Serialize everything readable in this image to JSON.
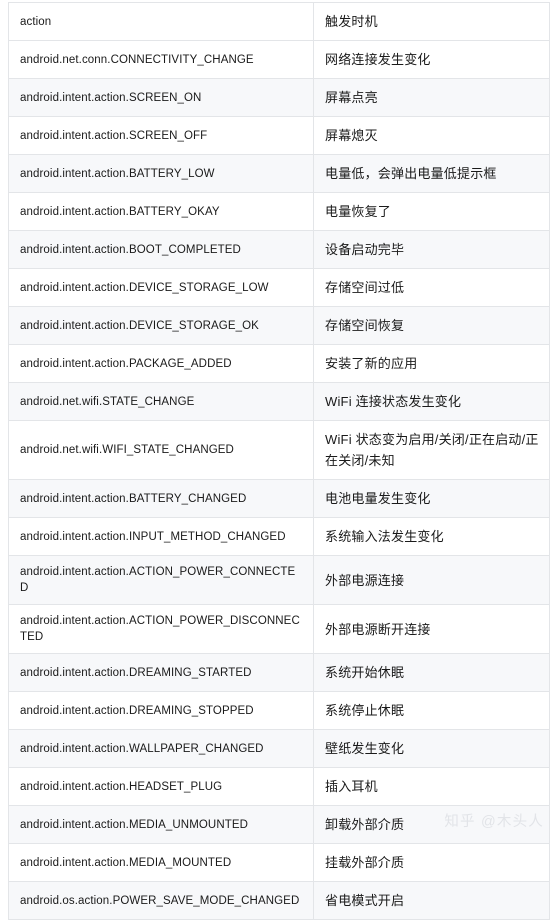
{
  "table": {
    "columns": [
      {
        "key": "action",
        "label": "action"
      },
      {
        "key": "trigger",
        "label": "触发时机"
      }
    ],
    "header": {
      "action": "action",
      "trigger": "触发时机"
    },
    "rows": [
      {
        "action": "android.net.conn.CONNECTIVITY_CHANGE",
        "trigger": "网络连接发生变化"
      },
      {
        "action": "android.intent.action.SCREEN_ON",
        "trigger": "屏幕点亮"
      },
      {
        "action": "android.intent.action.SCREEN_OFF",
        "trigger": "屏幕熄灭"
      },
      {
        "action": "android.intent.action.BATTERY_LOW",
        "trigger": "电量低，会弹出电量低提示框"
      },
      {
        "action": "android.intent.action.BATTERY_OKAY",
        "trigger": "电量恢复了"
      },
      {
        "action": "android.intent.action.BOOT_COMPLETED",
        "trigger": "设备启动完毕"
      },
      {
        "action": "android.intent.action.DEVICE_STORAGE_LOW",
        "trigger": "存储空间过低"
      },
      {
        "action": "android.intent.action.DEVICE_STORAGE_OK",
        "trigger": "存储空间恢复"
      },
      {
        "action": "android.intent.action.PACKAGE_ADDED",
        "trigger": "安装了新的应用"
      },
      {
        "action": "android.net.wifi.STATE_CHANGE",
        "trigger": "WiFi 连接状态发生变化"
      },
      {
        "action": "android.net.wifi.WIFI_STATE_CHANGED",
        "trigger": "WiFi 状态变为启用/关闭/正在启动/正在关闭/未知"
      },
      {
        "action": "android.intent.action.BATTERY_CHANGED",
        "trigger": "电池电量发生变化"
      },
      {
        "action": "android.intent.action.INPUT_METHOD_CHANGED",
        "trigger": "系统输入法发生变化"
      },
      {
        "action": "android.intent.action.ACTION_POWER_CONNECTED",
        "trigger": "外部电源连接"
      },
      {
        "action": "android.intent.action.ACTION_POWER_DISCONNECTED",
        "trigger": "外部电源断开连接"
      },
      {
        "action": "android.intent.action.DREAMING_STARTED",
        "trigger": "系统开始休眠"
      },
      {
        "action": "android.intent.action.DREAMING_STOPPED",
        "trigger": "系统停止休眠"
      },
      {
        "action": "android.intent.action.WALLPAPER_CHANGED",
        "trigger": "壁纸发生变化"
      },
      {
        "action": "android.intent.action.HEADSET_PLUG",
        "trigger": "插入耳机"
      },
      {
        "action": "android.intent.action.MEDIA_UNMOUNTED",
        "trigger": "卸载外部介质"
      },
      {
        "action": "android.intent.action.MEDIA_MOUNTED",
        "trigger": "挂载外部介质"
      },
      {
        "action": "android.os.action.POWER_SAVE_MODE_CHANGED",
        "trigger": "省电模式开启"
      }
    ]
  },
  "watermark": {
    "text": "知乎 @木头人"
  },
  "colors": {
    "border": "#e3e5e8",
    "stripe": "#f7f8fa",
    "background": "#ffffff",
    "text": "#1a1a1a",
    "watermark": "#e2e4e8"
  }
}
